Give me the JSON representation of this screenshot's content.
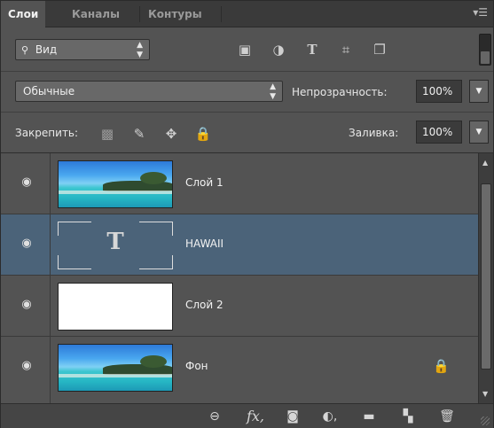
{
  "tabs": [
    {
      "label": "Слои",
      "active": true
    },
    {
      "label": "Каналы",
      "active": false
    },
    {
      "label": "Контуры",
      "active": false
    }
  ],
  "panel_menu_icon": "panel-menu-icon",
  "filter": {
    "kind_label": "Вид",
    "icons": [
      "image-filter-icon",
      "adjustment-filter-icon",
      "type-filter-icon",
      "shape-filter-icon",
      "smart-object-filter-icon"
    ]
  },
  "blend": {
    "mode": "Обычные",
    "opacity_label": "Непрозрачность:",
    "opacity_value": "100%"
  },
  "lock": {
    "label": "Закрепить:",
    "icons": [
      "lock-transparent-icon",
      "lock-image-icon",
      "lock-position-icon",
      "lock-all-icon"
    ],
    "fill_label": "Заливка:",
    "fill_value": "100%"
  },
  "layers": [
    {
      "name": "Слой 1",
      "thumb": "sea",
      "selected": false,
      "locked": false
    },
    {
      "name": "HAWAII",
      "thumb": "text",
      "selected": true,
      "locked": false
    },
    {
      "name": "Слой 2",
      "thumb": "white",
      "selected": false,
      "locked": false
    },
    {
      "name": "Фон",
      "thumb": "sea",
      "selected": false,
      "locked": true
    }
  ],
  "bottom_bar": {
    "icons": [
      "link-layers-icon",
      "fx-icon",
      "add-mask-icon",
      "adjustment-layer-icon",
      "new-group-icon",
      "new-layer-icon",
      "delete-layer-icon"
    ],
    "fx_label": "fx"
  },
  "colors": {
    "panel": "#535353",
    "selected_layer": "#4b6379",
    "tabbar": "#3a3a3a"
  }
}
